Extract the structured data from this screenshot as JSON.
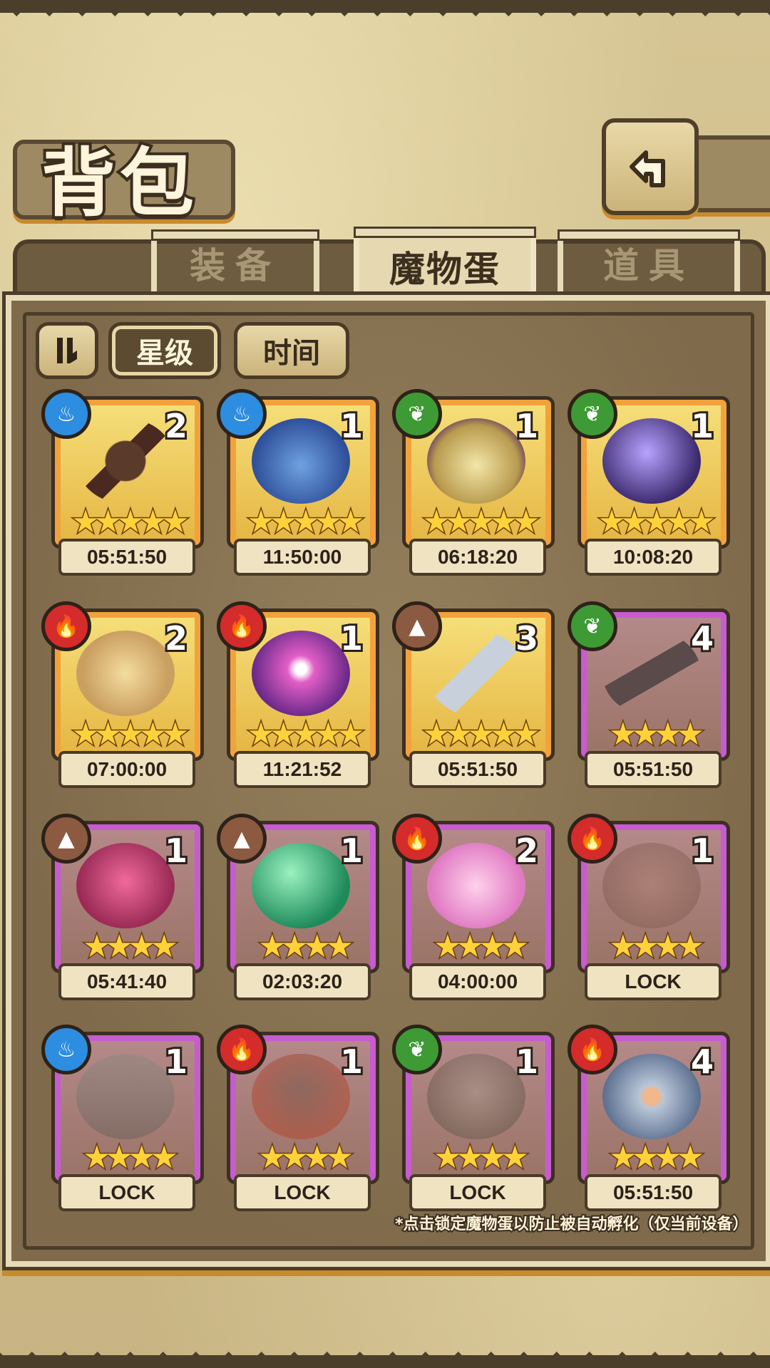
{
  "header": {
    "title": "背包"
  },
  "tabs": [
    {
      "label": "装备"
    },
    {
      "label": "魔物蛋"
    },
    {
      "label": "道具"
    }
  ],
  "sort": {
    "star_label": "星级",
    "time_label": "时间"
  },
  "eggs": [
    {
      "element": "water",
      "count": "2",
      "stars": "★★★★★",
      "timer": "05:51:50",
      "rarity": "gold",
      "art": "staff"
    },
    {
      "element": "water",
      "count": "1",
      "stars": "★★★★★",
      "timer": "11:50:00",
      "rarity": "gold",
      "art": "shark"
    },
    {
      "element": "leaf",
      "count": "1",
      "stars": "★★★★★",
      "timer": "06:18:20",
      "rarity": "gold",
      "art": "lamp"
    },
    {
      "element": "leaf",
      "count": "1",
      "stars": "★★★★★",
      "timer": "10:08:20",
      "rarity": "gold",
      "art": "crystal-egg"
    },
    {
      "element": "fire",
      "count": "2",
      "stars": "★★★★★",
      "timer": "07:00:00",
      "rarity": "gold",
      "art": "tiger-egg"
    },
    {
      "element": "fire",
      "count": "1",
      "stars": "★★★★★",
      "timer": "11:21:52",
      "rarity": "gold",
      "art": "eye-orb"
    },
    {
      "element": "earth",
      "count": "3",
      "stars": "★★★★★",
      "timer": "05:51:50",
      "rarity": "gold",
      "art": "sword"
    },
    {
      "element": "leaf",
      "count": "4",
      "stars": "★★★★",
      "timer": "05:51:50",
      "rarity": "purple",
      "art": "kunai"
    },
    {
      "element": "earth",
      "count": "1",
      "stars": "★★★★",
      "timer": "05:41:40",
      "rarity": "purple",
      "art": "thorn-egg"
    },
    {
      "element": "earth",
      "count": "1",
      "stars": "★★★★",
      "timer": "02:03:20",
      "rarity": "purple",
      "art": "green-orb"
    },
    {
      "element": "fire",
      "count": "2",
      "stars": "★★★★",
      "timer": "04:00:00",
      "rarity": "purple",
      "art": "pink-slime"
    },
    {
      "element": "fire",
      "count": "1",
      "stars": "★★★★",
      "timer": "LOCK",
      "rarity": "purple",
      "art": "bat-egg"
    },
    {
      "element": "water",
      "count": "1",
      "stars": "★★★★",
      "timer": "LOCK",
      "rarity": "purple",
      "art": "ship"
    },
    {
      "element": "fire",
      "count": "1",
      "stars": "★★★★",
      "timer": "LOCK",
      "rarity": "purple",
      "art": "lava-egg"
    },
    {
      "element": "leaf",
      "count": "1",
      "stars": "★★★★",
      "timer": "LOCK",
      "rarity": "purple",
      "art": "spike-egg"
    },
    {
      "element": "fire",
      "count": "4",
      "stars": "★★★★",
      "timer": "05:51:50",
      "rarity": "purple",
      "art": "shield"
    }
  ],
  "footer_note": "*点击锁定魔物蛋以防止被自动孵化（仅当前设备）",
  "colors": {
    "gold_frame": "#f2a23c",
    "purple_frame": "#c75bd0",
    "water": "#2d8de0",
    "fire": "#d42b2b",
    "leaf": "#3e9a35",
    "earth": "#8b5a40"
  }
}
